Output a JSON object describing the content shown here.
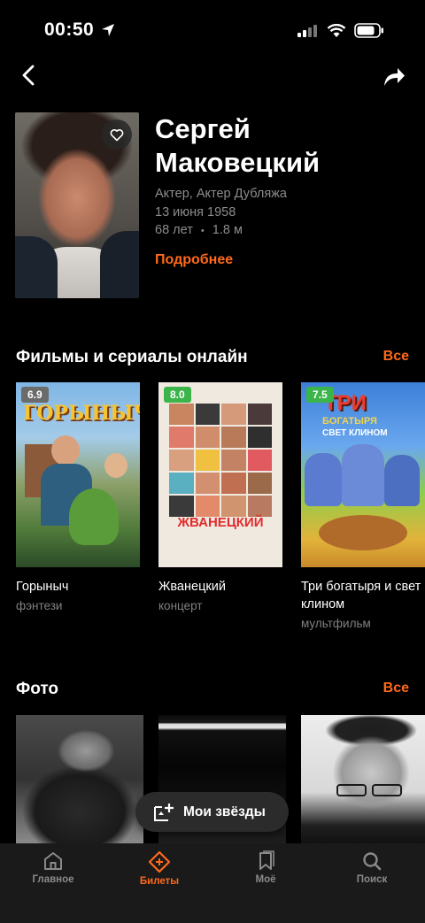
{
  "status": {
    "time": "00:50"
  },
  "person": {
    "name_line1": "Сергей",
    "name_line2": "Маковецкий",
    "roles": "Актер, Актер Дубляжа",
    "birth_date": "13 июня 1958",
    "age": "68 лет",
    "bullet": "•",
    "followers": "1.8 м",
    "more_link": "Подробнее"
  },
  "films_section": {
    "title": "Фильмы и сериалы онлайн",
    "see_all": "Все",
    "items": [
      {
        "rating": "6.9",
        "rating_color": "#6b6b6b",
        "title": "Горыныч",
        "genre": "фэнтези",
        "poster_text": "ГОРЫНЫЧ"
      },
      {
        "rating": "8.0",
        "rating_color": "#3bb54a",
        "title": "Жванецкий",
        "genre": "концерт",
        "poster_text": "ЖВАНЕЦКИЙ"
      },
      {
        "rating": "7.5",
        "rating_color": "#3bb54a",
        "title": "Три богатыря и свет клином",
        "genre": "мультфильм",
        "poster_text_top": "ТРИ",
        "poster_text_mid": "БОГАТЫРЯ",
        "poster_text_bot": "СВЕТ КЛИНОМ"
      }
    ]
  },
  "photos_section": {
    "title": "Фото",
    "see_all": "Все"
  },
  "floating_button": {
    "label": "Мои звёзды"
  },
  "tab_bar": {
    "tabs": [
      {
        "label": "Главное"
      },
      {
        "label": "Билеты"
      },
      {
        "label": "Моё"
      },
      {
        "label": "Поиск"
      }
    ],
    "active_index": 1
  },
  "colors": {
    "accent": "#ff6a1a",
    "rating_green": "#3bb54a",
    "rating_gray": "#6b6b6b"
  }
}
